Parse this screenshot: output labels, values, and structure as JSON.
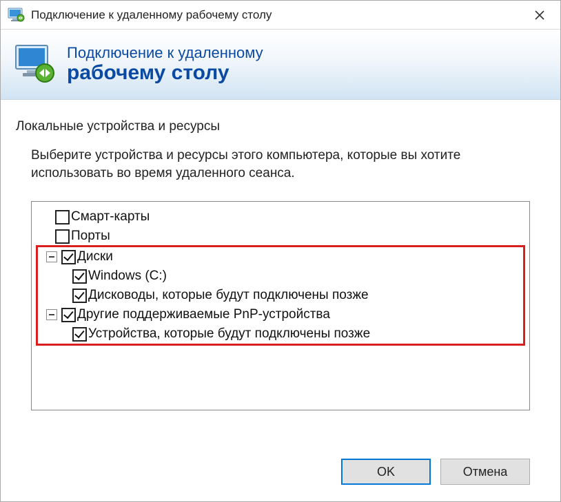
{
  "titlebar": {
    "title": "Подключение к удаленному рабочему столу"
  },
  "banner": {
    "line1": "Подключение к удаленному",
    "line2": "рабочему столу"
  },
  "section": {
    "title": "Локальные устройства и ресурсы",
    "instruction": "Выберите устройства и ресурсы этого компьютера, которые вы хотите использовать во время удаленного сеанса."
  },
  "tree": {
    "smartcards": "Смарт-карты",
    "ports": "Порты",
    "drives": "Диски",
    "windows_c": "Windows (C:)",
    "drives_later": "Дисководы, которые будут подключены позже",
    "pnp": "Другие поддерживаемые PnP-устройства",
    "pnp_later": "Устройства, которые будут подключены позже"
  },
  "buttons": {
    "ok": "OK",
    "cancel": "Отмена"
  }
}
